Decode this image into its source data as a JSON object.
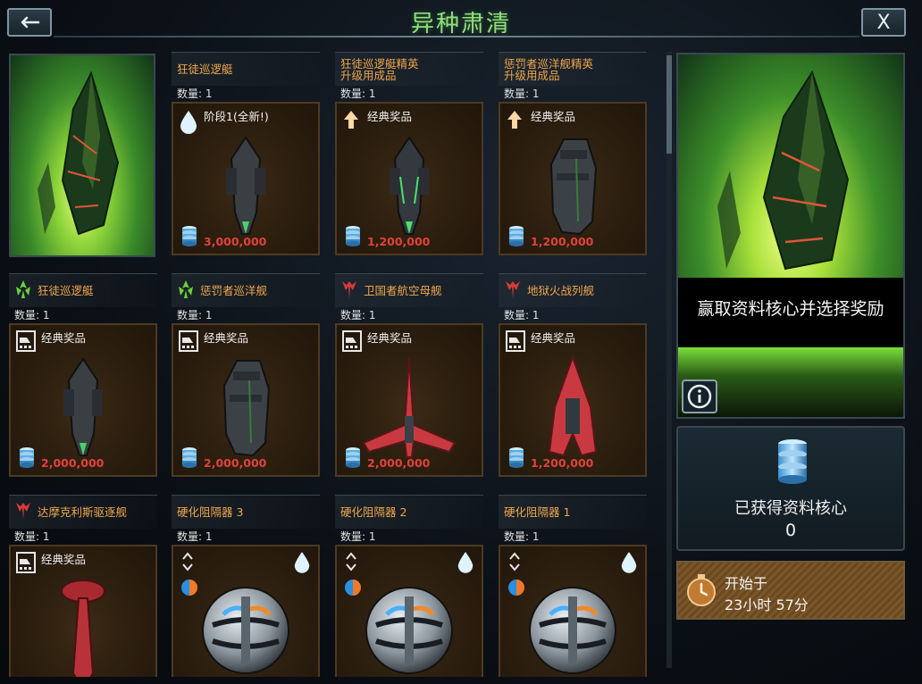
{
  "header": {
    "title": "异种肃清",
    "back_icon": "return-arrow-icon",
    "close_label": "X"
  },
  "cards": [
    {
      "title": "狂徒巡逻艇",
      "qty": "数量: 1",
      "body_label": "阶段1(全新!)",
      "type_icon": "drop-icon",
      "price": "3,000,000",
      "ship": "dark-cruiser"
    },
    {
      "title": "狂徒巡逻艇精英\n升级用成品",
      "qty": "数量: 1",
      "body_label": "经典奖品",
      "type_icon": "up-arrow-icon",
      "price": "1,200,000",
      "ship": "dark-cruiser-green"
    },
    {
      "title": "惩罚者巡洋舰精英\n升级用成品",
      "qty": "数量: 1",
      "body_label": "经典奖品",
      "type_icon": "up-arrow-icon",
      "price": "1,200,000",
      "ship": "dark-block"
    },
    {
      "title": "狂徒巡逻艇",
      "qty": "数量: 1",
      "body_label": "经典奖品",
      "type_icon": "blueprint-icon",
      "price": "2,000,000",
      "ship": "dark-cruiser",
      "faction": "green"
    },
    {
      "title": "惩罚者巡洋舰",
      "qty": "数量: 1",
      "body_label": "经典奖品",
      "type_icon": "blueprint-icon",
      "price": "2,000,000",
      "ship": "dark-block",
      "faction": "green"
    },
    {
      "title": "卫国者航空母舰",
      "qty": "数量: 1",
      "body_label": "经典奖品",
      "type_icon": "blueprint-icon",
      "price": "2,000,000",
      "ship": "red-wing",
      "faction": "red"
    },
    {
      "title": "地狱火战列舰",
      "qty": "数量: 1",
      "body_label": "经典奖品",
      "type_icon": "blueprint-icon",
      "price": "1,200,000",
      "ship": "red-hull",
      "faction": "red"
    },
    {
      "title": "达摩克利斯驱逐舰",
      "qty": "数量: 1",
      "body_label": "经典奖品",
      "type_icon": "blueprint-icon",
      "price": "",
      "ship": "red-needle",
      "faction": "red"
    },
    {
      "title": "硬化阻隔器 3",
      "qty": "数量: 1",
      "body_label": "",
      "type_icon": "module",
      "price": "",
      "ship": "sphere"
    },
    {
      "title": "硬化阻隔器 2",
      "qty": "数量: 1",
      "body_label": "",
      "type_icon": "module",
      "price": "",
      "ship": "sphere"
    },
    {
      "title": "硬化阻隔器 1",
      "qty": "数量: 1",
      "body_label": "",
      "type_icon": "module",
      "price": "",
      "ship": "sphere"
    }
  ],
  "promo": {
    "text": "赢取资料核心并选择奖励"
  },
  "core": {
    "label": "已获得资料核心",
    "count": "0"
  },
  "timer": {
    "start_label": "开始于",
    "value": "23小时 57分"
  },
  "colors": {
    "title_green": "#8fe07a",
    "card_title_orange": "#f0a64a",
    "price_red": "#e0413b",
    "faction_green": "#6ad33a",
    "faction_red": "#d63a3a"
  }
}
